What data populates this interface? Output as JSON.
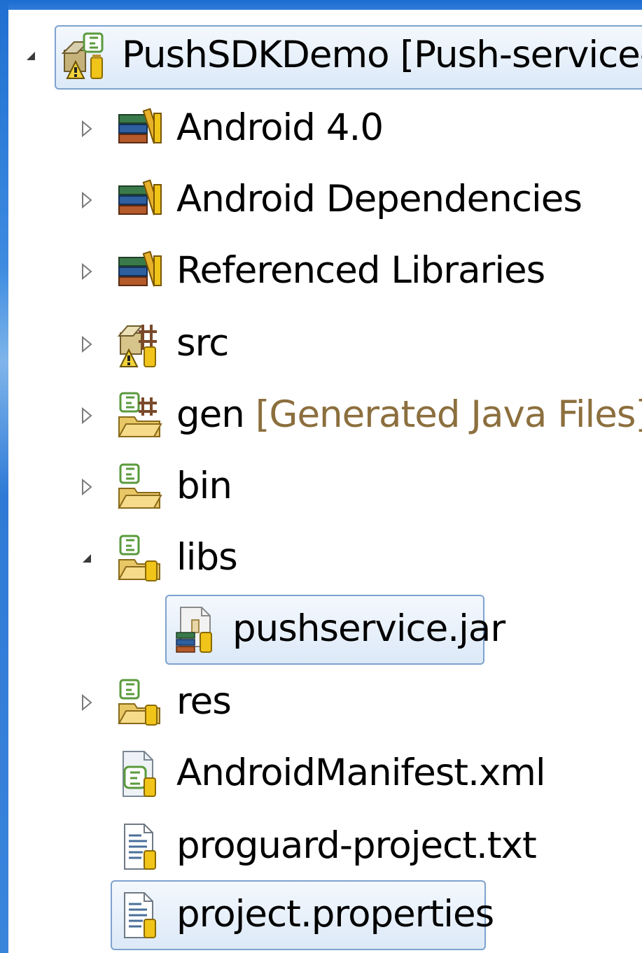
{
  "tree": {
    "project": {
      "label": "PushSDKDemo [Push-service-d",
      "expanded": true
    },
    "children": [
      {
        "label": "Android 4.0",
        "icon": "library-stack-icon",
        "expanded": false
      },
      {
        "label": "Android Dependencies",
        "icon": "library-stack-icon",
        "expanded": false
      },
      {
        "label": "Referenced Libraries",
        "icon": "library-stack-icon",
        "expanded": false
      },
      {
        "label": "src",
        "icon": "source-package-icon",
        "expanded": false
      },
      {
        "label": "gen",
        "decoration": "[Generated Java Files]",
        "icon": "generated-folder-icon",
        "expanded": false
      },
      {
        "label": "bin",
        "icon": "folder-icon",
        "expanded": false
      },
      {
        "label": "libs",
        "icon": "folder-icon",
        "expanded": true
      },
      {
        "label": "pushservice.jar",
        "icon": "jar-file-icon"
      },
      {
        "label": "res",
        "icon": "folder-icon",
        "expanded": false
      },
      {
        "label": "AndroidManifest.xml",
        "icon": "xml-file-icon"
      },
      {
        "label": "proguard-project.txt",
        "icon": "text-file-icon"
      },
      {
        "label": "project.properties",
        "icon": "text-file-icon"
      }
    ]
  },
  "colors": {
    "selection_border": "#7da2ce",
    "selection_fill": "#dce9f8",
    "decoration_text": "#8c6f3e",
    "window_frame": "#2f7ad6"
  }
}
